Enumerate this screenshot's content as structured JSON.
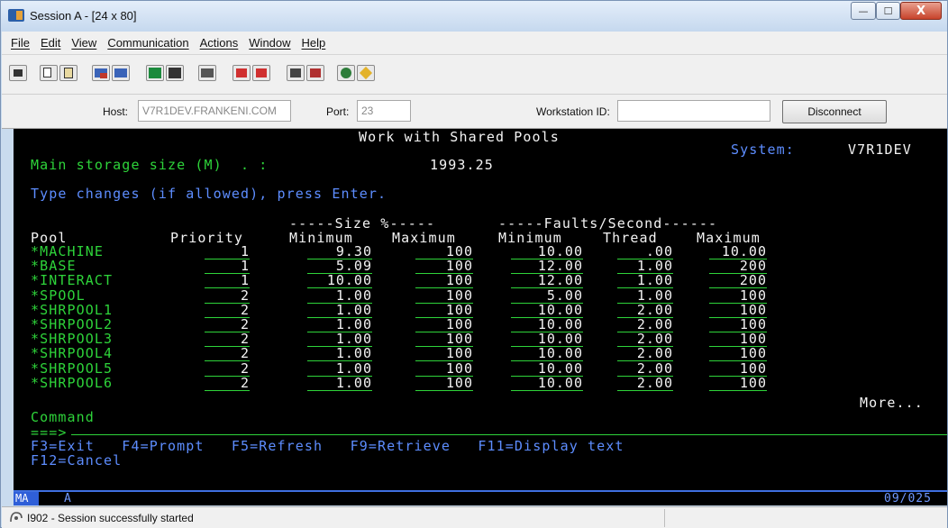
{
  "window": {
    "title": "Session A - [24 x 80]",
    "minimize_glyph": "—",
    "maximize_glyph": "☐",
    "close_glyph": "X"
  },
  "menu": [
    "File",
    "Edit",
    "View",
    "Communication",
    "Actions",
    "Window",
    "Help"
  ],
  "toolbar": {
    "icons": [
      "print-screen-icon",
      "copy-icon",
      "paste-icon",
      "send-icon",
      "receive-icon",
      "display-icon",
      "keypad-icon",
      "macro-record-icon",
      "macro-play-icon",
      "macro-stop-icon",
      "file-send-icon",
      "file-receive-icon",
      "color-map-icon",
      "help-icon"
    ]
  },
  "hostbar": {
    "host_label": "Host:",
    "host_value": "V7R1DEV.FRANKENI.COM",
    "port_label": "Port:",
    "port_value": "23",
    "workstation_label": "Workstation ID:",
    "workstation_value": "",
    "disconnect_label": "Disconnect"
  },
  "screen": {
    "title": "Work with Shared Pools",
    "system_label": "System:",
    "system_value": "V7R1DEV",
    "main_storage_label": "Main storage size (M)  . :",
    "main_storage_value": "1993.25",
    "instruction": "Type changes (if allowed), press Enter.",
    "size_group": "-----Size %-----",
    "faults_group": "-----Faults/Second------",
    "headers": {
      "pool": "Pool",
      "priority": "Priority",
      "size_min": "Minimum",
      "size_max": "Maximum",
      "faults_min": "Minimum",
      "thread": "Thread",
      "faults_max": "Maximum"
    },
    "rows": [
      {
        "pool": "*MACHINE",
        "priority": "1",
        "size_min": "9.30",
        "size_max": "100",
        "faults_min": "10.00",
        "thread": ".00",
        "faults_max": "10.00"
      },
      {
        "pool": "*BASE",
        "priority": "1",
        "size_min": "5.09",
        "size_max": "100",
        "faults_min": "12.00",
        "thread": "1.00",
        "faults_max": "200"
      },
      {
        "pool": "*INTERACT",
        "priority": "1",
        "size_min": "10.00",
        "size_max": "100",
        "faults_min": "12.00",
        "thread": "1.00",
        "faults_max": "200"
      },
      {
        "pool": "*SPOOL",
        "priority": "2",
        "size_min": "1.00",
        "size_max": "100",
        "faults_min": "5.00",
        "thread": "1.00",
        "faults_max": "100"
      },
      {
        "pool": "*SHRPOOL1",
        "priority": "2",
        "size_min": "1.00",
        "size_max": "100",
        "faults_min": "10.00",
        "thread": "2.00",
        "faults_max": "100"
      },
      {
        "pool": "*SHRPOOL2",
        "priority": "2",
        "size_min": "1.00",
        "size_max": "100",
        "faults_min": "10.00",
        "thread": "2.00",
        "faults_max": "100"
      },
      {
        "pool": "*SHRPOOL3",
        "priority": "2",
        "size_min": "1.00",
        "size_max": "100",
        "faults_min": "10.00",
        "thread": "2.00",
        "faults_max": "100"
      },
      {
        "pool": "*SHRPOOL4",
        "priority": "2",
        "size_min": "1.00",
        "size_max": "100",
        "faults_min": "10.00",
        "thread": "2.00",
        "faults_max": "100"
      },
      {
        "pool": "*SHRPOOL5",
        "priority": "2",
        "size_min": "1.00",
        "size_max": "100",
        "faults_min": "10.00",
        "thread": "2.00",
        "faults_max": "100"
      },
      {
        "pool": "*SHRPOOL6",
        "priority": "2",
        "size_min": "1.00",
        "size_max": "100",
        "faults_min": "10.00",
        "thread": "2.00",
        "faults_max": "100"
      }
    ],
    "more": "More...",
    "command_label": "Command",
    "command_prompt": "===>",
    "fkeys_line1": "F3=Exit   F4=Prompt   F5=Refresh   F9=Retrieve   F11=Display text",
    "fkeys_line2": "F12=Cancel"
  },
  "oia": {
    "indicator": "MA",
    "mode": "A",
    "cursor": "09/025"
  },
  "status": {
    "message": "I902 - Session successfully started"
  },
  "colors": {
    "terminal_bg": "#000000",
    "terminal_green": "#2ed43a",
    "terminal_white": "#f4f4f4",
    "terminal_blue": "#5d8dff"
  }
}
